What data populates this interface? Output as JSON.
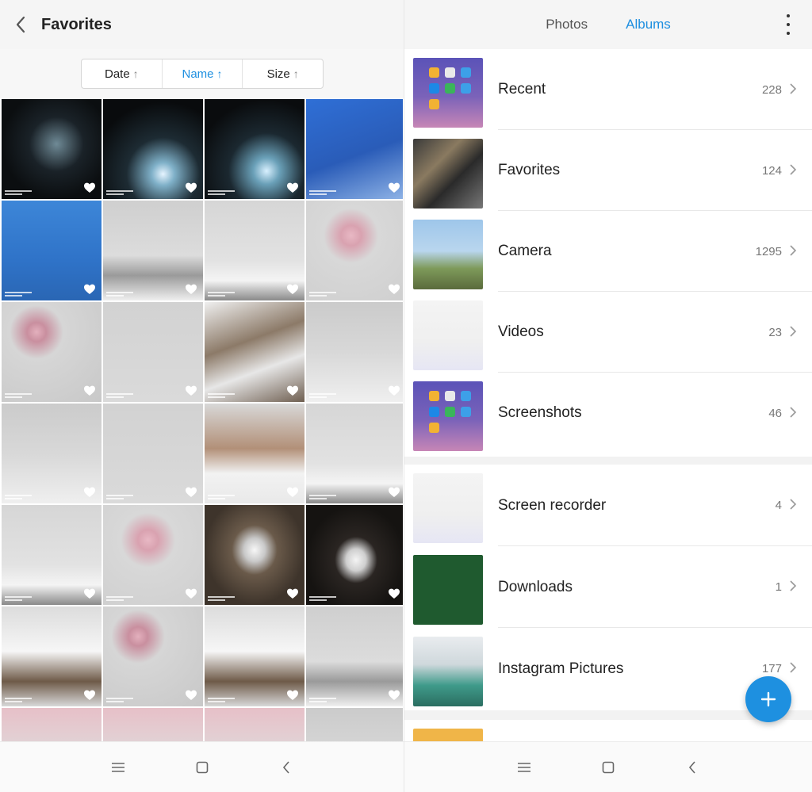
{
  "left": {
    "header": {
      "title": "Favorites",
      "back_icon": "chevron-left-icon"
    },
    "sort": [
      {
        "label": "Date",
        "arrow": "↑",
        "active": false
      },
      {
        "label": "Name",
        "arrow": "↑",
        "active": true
      },
      {
        "label": "Size",
        "arrow": "↑",
        "active": false
      }
    ],
    "photos": [
      "p-dark1",
      "p-dark2",
      "p-dark3",
      "p-blue1",
      "p-blue2",
      "p-snow1",
      "p-snow2",
      "p-blossom",
      "p-blossom2",
      "p-branch",
      "p-rock",
      "p-fog",
      "p-fog",
      "p-branch",
      "p-wall",
      "p-snow2",
      "p-snow2",
      "p-blossom",
      "p-tunnel",
      "p-tunnel2",
      "p-snowy",
      "p-blossom2",
      "p-snowy",
      "p-snow1",
      "p-pink",
      "p-pink",
      "p-pink",
      "p-fog"
    ],
    "navbar": [
      "menu-icon",
      "home-icon",
      "back-icon"
    ]
  },
  "right": {
    "tabs": [
      {
        "label": "Photos",
        "active": false
      },
      {
        "label": "Albums",
        "active": true
      }
    ],
    "more_icon": "more-vertical-icon",
    "albums_group1": [
      {
        "name": "Recent",
        "count": "228",
        "thumb": "t-phone"
      },
      {
        "name": "Favorites",
        "count": "124",
        "thumb": "t-fav"
      },
      {
        "name": "Camera",
        "count": "1295",
        "thumb": "t-camera"
      },
      {
        "name": "Videos",
        "count": "23",
        "thumb": "t-video"
      },
      {
        "name": "Screenshots",
        "count": "46",
        "thumb": "t-phone"
      }
    ],
    "albums_group2": [
      {
        "name": "Screen recorder",
        "count": "4",
        "thumb": "t-rec"
      },
      {
        "name": "Downloads",
        "count": "1",
        "thumb": "t-dl"
      },
      {
        "name": "Instagram Pictures",
        "count": "177",
        "thumb": "t-insta"
      }
    ],
    "albums_group3": [
      {
        "name": "",
        "count": "",
        "thumb": "t-yellow"
      }
    ],
    "fab_icon": "plus-icon",
    "navbar": [
      "menu-icon",
      "home-icon",
      "back-icon"
    ]
  },
  "colors": {
    "accent": "#1e8fe0",
    "fab": "#1e90e0"
  }
}
